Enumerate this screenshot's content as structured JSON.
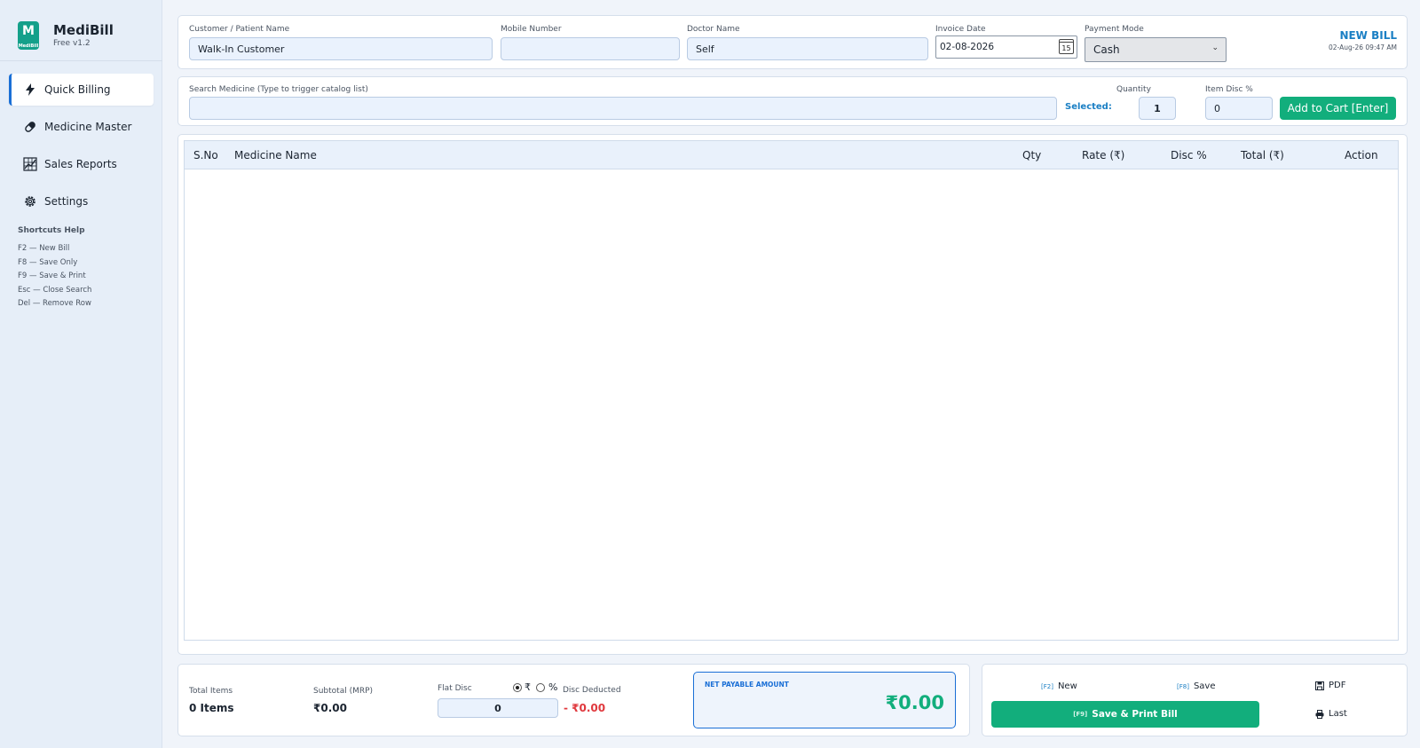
{
  "app": {
    "name": "MediBill",
    "version": "Free v1.2",
    "logo_text": "MediBill"
  },
  "nav": [
    {
      "label": "Quick Billing",
      "icon": "bolt-icon",
      "active": true
    },
    {
      "label": "Medicine Master",
      "icon": "pill-icon"
    },
    {
      "label": "Sales Reports",
      "icon": "chart-icon"
    },
    {
      "label": "Settings",
      "icon": "gear-icon"
    }
  ],
  "shortcuts": {
    "title": "Shortcuts Help",
    "items": [
      "F2  — New Bill",
      "F8  — Save Only",
      "F9  — Save & Print",
      "Esc — Close Search",
      "Del — Remove Row"
    ]
  },
  "form": {
    "customer_label": "Customer / Patient Name",
    "customer_value": "Walk-In Customer",
    "mobile_label": "Mobile Number",
    "mobile_value": "",
    "doctor_label": "Doctor Name",
    "doctor_value": "Self",
    "date_label": "Invoice Date",
    "date_value": "02-08-2026",
    "calendar_day": "15",
    "payment_label": "Payment Mode",
    "payment_value": "Cash"
  },
  "bill": {
    "title": "NEW BILL",
    "timestamp": "02-Aug-26 09:47 AM"
  },
  "search": {
    "label": "Search Medicine (Type to trigger catalog list)",
    "value": "",
    "selected_label": "Selected:",
    "qty_label": "Quantity",
    "qty_value": "1",
    "disc_label": "Item Disc %",
    "disc_value": "0",
    "add_button": "Add to Cart [Enter]"
  },
  "table": {
    "columns": [
      "S.No",
      "Medicine Name",
      "Qty",
      "Rate (₹)",
      "Disc %",
      "Total (₹)",
      "Action"
    ],
    "rows": []
  },
  "summary": {
    "total_items_label": "Total Items",
    "total_items_value": "0 Items",
    "subtotal_label": "Subtotal (MRP)",
    "subtotal_value": "₹0.00",
    "flat_disc_label": "Flat Disc",
    "flat_disc_value": "0",
    "disc_type_rupee": "₹",
    "disc_type_percent": "%",
    "disc_deducted_label": "Disc Deducted",
    "disc_deducted_value": "- ₹0.00",
    "net_label": "NET PAYABLE AMOUNT",
    "net_value": "₹0.00"
  },
  "actions": {
    "new_key": "[F2]",
    "new_label": "New",
    "save_key": "[F8]",
    "save_label": "Save",
    "pdf_label": "PDF",
    "print_key": "[F9]",
    "print_label": "Save & Print Bill",
    "last_label": "Last"
  },
  "colors": {
    "accent": "#1a6fd6",
    "green": "#12ae7c",
    "red": "#e0393e",
    "bill_blue": "#1a7fc4"
  }
}
